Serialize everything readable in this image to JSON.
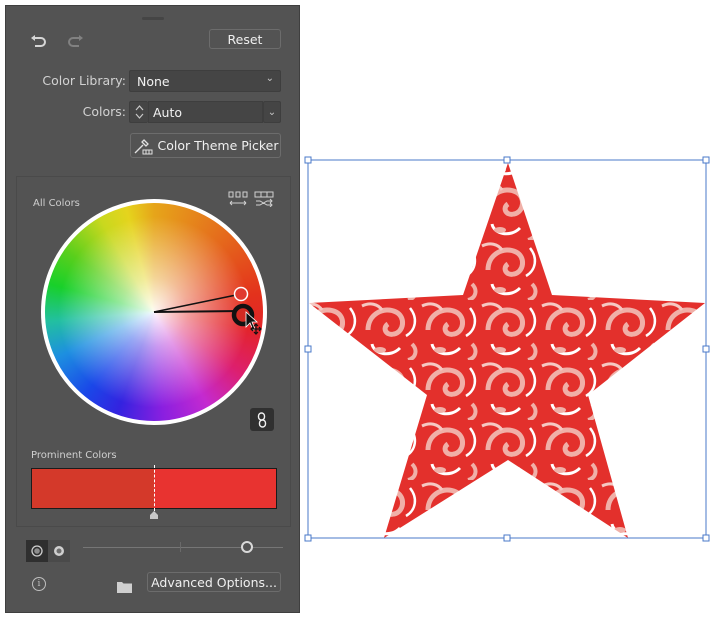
{
  "panel": {
    "undo_icon": "undo-icon",
    "redo_icon": "redo-icon",
    "reset_label": "Reset",
    "color_library": {
      "label": "Color Library:",
      "value": "None"
    },
    "colors": {
      "label": "Colors:",
      "value": "Auto"
    },
    "color_theme_picker_label": "Color Theme Picker",
    "wheel_section": {
      "all_colors_label": "All Colors",
      "wheel_icons": [
        "distribute-colors-icon",
        "randomize-colors-icon"
      ],
      "link_icon": "link-harmony-icon",
      "handles": [
        {
          "name": "selected-color-handle",
          "color": "#e03a30"
        },
        {
          "name": "base-color-handle",
          "color": "#d32a22"
        }
      ]
    },
    "prominent_colors": {
      "label": "Prominent Colors",
      "swatches": [
        {
          "color": "#d4392a",
          "fraction": 0.5
        },
        {
          "color": "#e83330",
          "fraction": 0.5
        }
      ]
    },
    "view_modes": [
      "smooth-wheel-icon",
      "segmented-wheel-icon"
    ],
    "brightness_slider": {
      "value": 0.82
    },
    "advanced_options_label": "Advanced Options...",
    "info_icon": "info-icon",
    "folder_icon": "folder-icon"
  },
  "canvas": {
    "artwork": "star-shape",
    "pattern_colors": {
      "primary": "#e3302c",
      "secondary": "#f0b0a8",
      "background": "#ffffff"
    },
    "selection_color": "#4a78c8"
  }
}
